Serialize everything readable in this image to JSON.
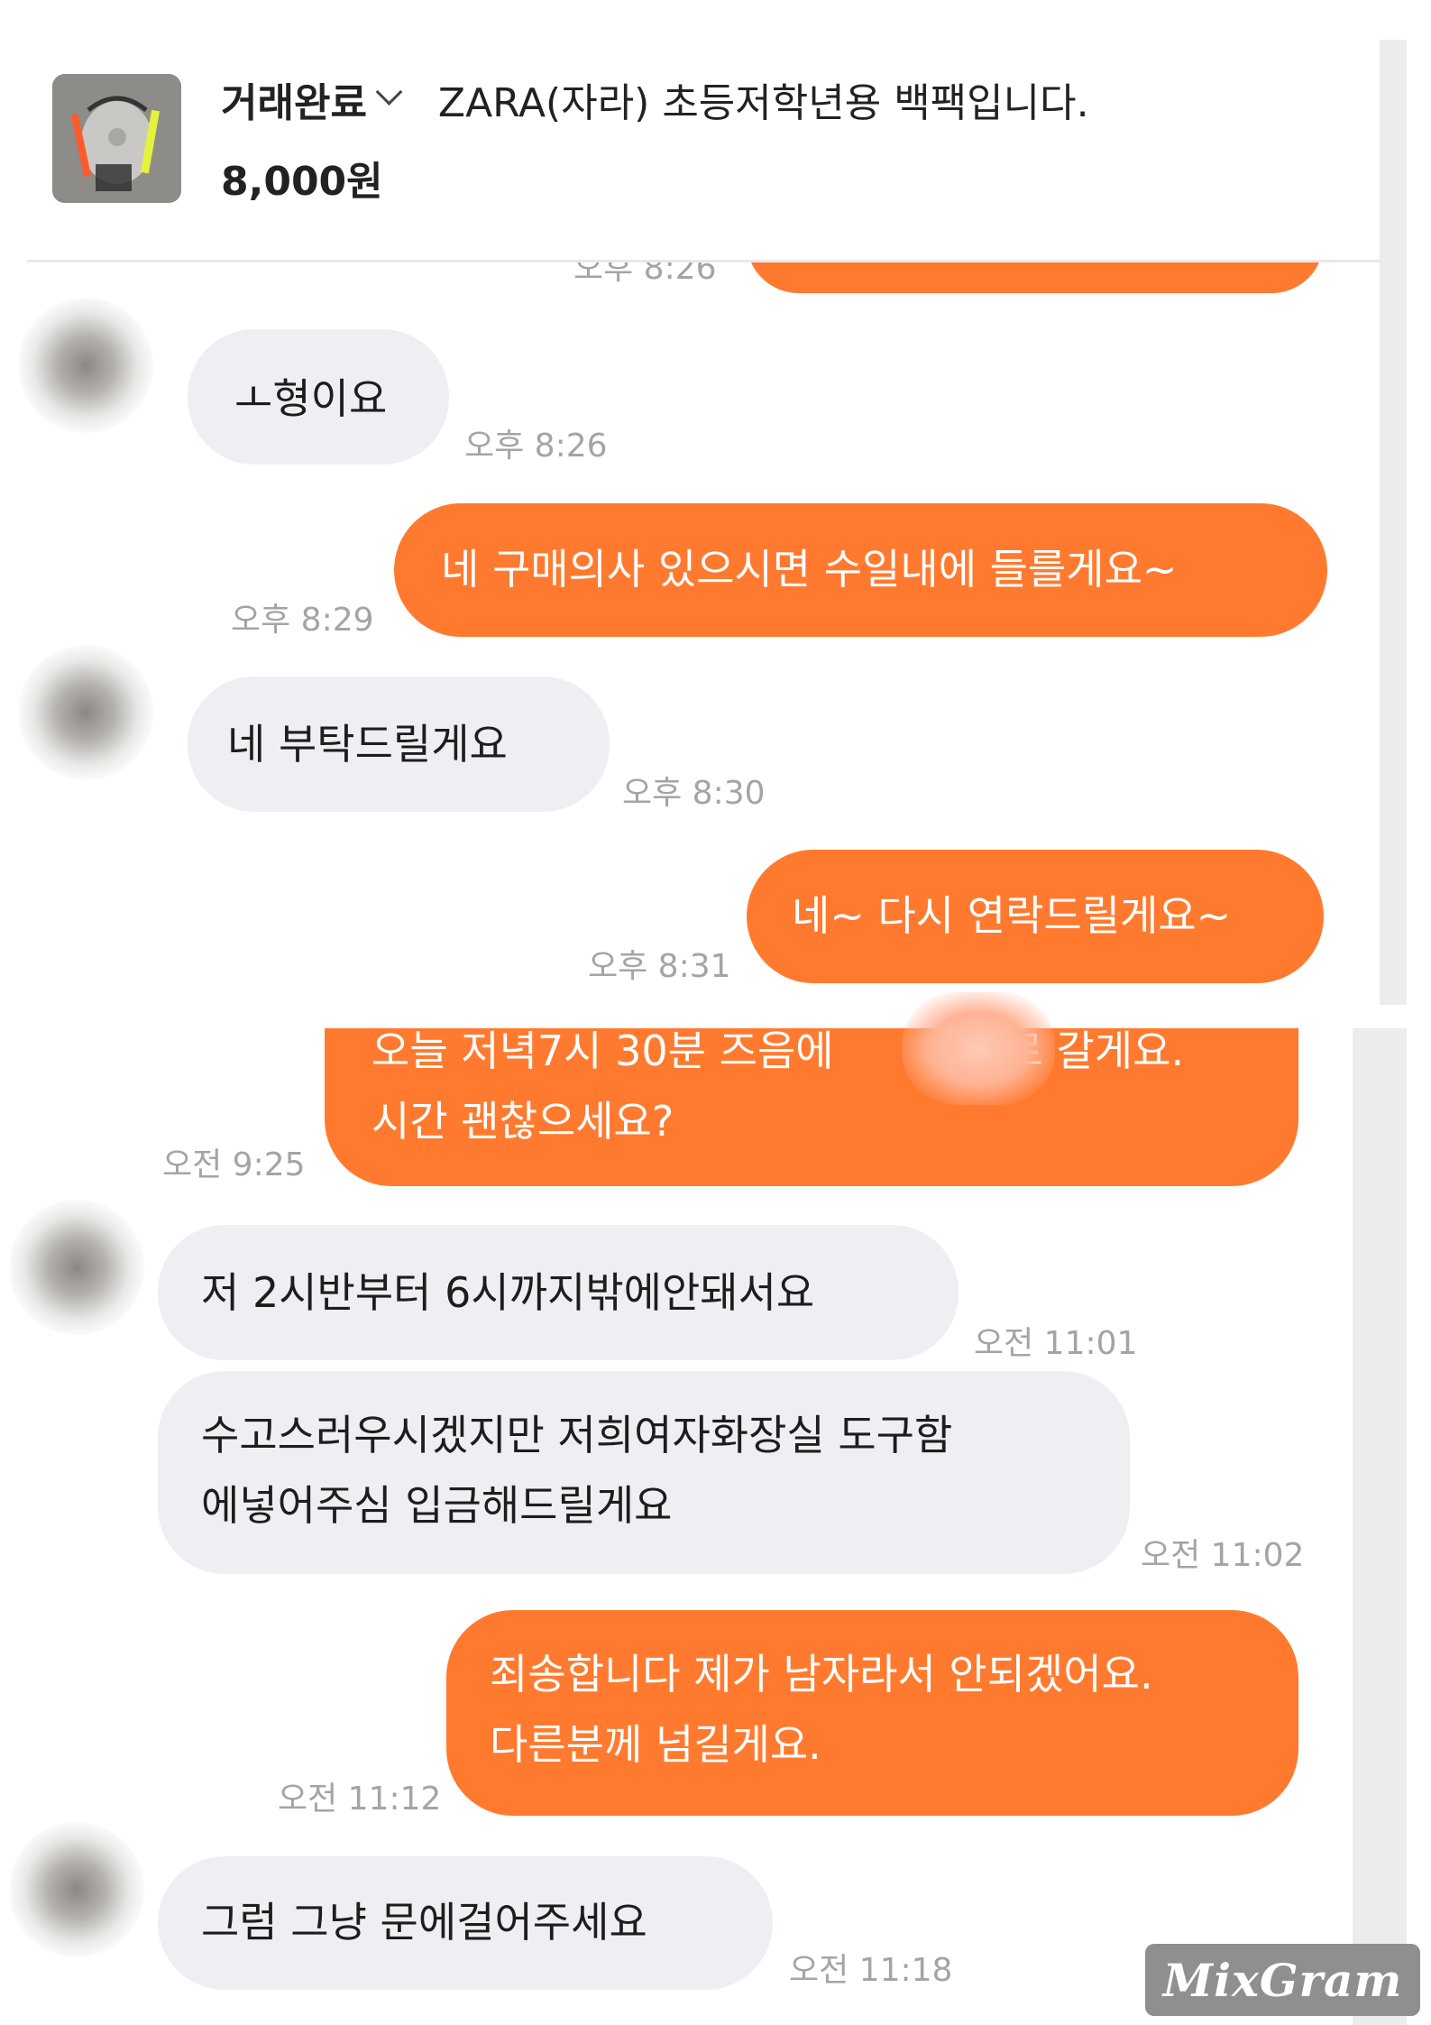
{
  "header": {
    "status": "거래완료",
    "product_title": "ZARA(자라) 초등저학년용 백팩입니다.",
    "price": "8,000원",
    "thumbnail_icon": "backpack-photo"
  },
  "messages": {
    "m0_time": "오후 8:26",
    "m1_text": "ㅗ형이요",
    "m1_time": "오후 8:26",
    "m2_text": "네 구매의사 있으시면 수일내에 들를게요~",
    "m2_time": "오후 8:29",
    "m3_text": "네 부탁드릴게요",
    "m3_time": "오후 8:30",
    "m4_text": "네~ 다시 연락드릴게요~",
    "m4_time": "오후 8:31",
    "m5_line1": "오늘 저녁7시 30분 즈음에",
    "m5_line1b": "로 갈게요.",
    "m5_line2": "시간 괜찮으세요?",
    "m5_time": "오전 9:25",
    "m6_text": "저 2시반부터 6시까지밖에안돼서요",
    "m6_time": "오전 11:01",
    "m7_line1": "수고스러우시겠지만 저희여자화장실 도구함",
    "m7_line2": "에넣어주심 입금해드릴게요",
    "m7_time": "오전 11:02",
    "m8_line1": "죄송합니다 제가 남자라서 안되겠어요.",
    "m8_line2": "다른분께 넘길게요.",
    "m8_time": "오전 11:12",
    "m9_text": "그럼 그냥 문에걸어주세요",
    "m9_time": "오전 11:18"
  },
  "watermark": "MixGram",
  "colors": {
    "outgoing_bubble": "#ff7a2f",
    "incoming_bubble": "#eeeff2",
    "timestamp": "#a4a4a8"
  }
}
